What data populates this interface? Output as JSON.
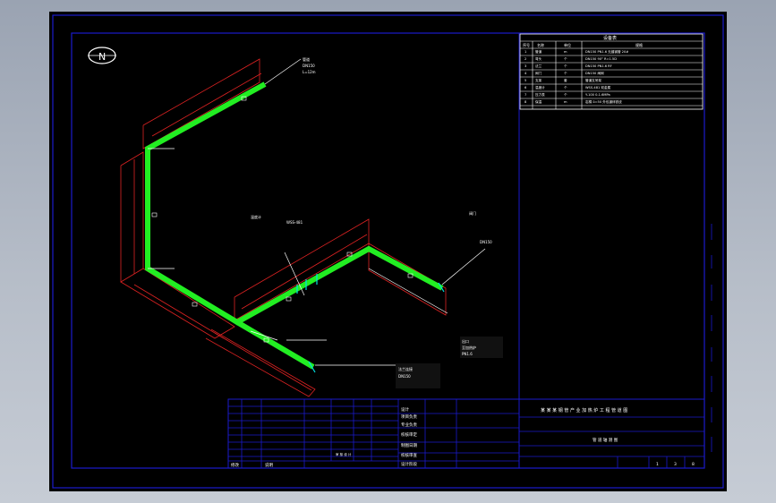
{
  "drawing": {
    "north_symbol": "N",
    "title_block": {
      "labels": [
        "设计",
        "项目负责",
        "专业负责",
        "校核审定",
        "制图日期",
        "校核审查",
        "设计阶段"
      ],
      "title": "某 某 某 钢 管 产 业 加 热 炉 工 程 管 道 图",
      "subtitle": "管 道 轴 测 图",
      "bottom_left_1": "修改",
      "bottom_left_2": "说明",
      "center_note": "审  核  设  计",
      "sheet_values": [
        "1",
        "3",
        "8"
      ]
    },
    "legend": {
      "header": "设备表",
      "columns": [
        "序号",
        "名称",
        "单位",
        "规格"
      ],
      "rows": [
        [
          "1",
          "管道",
          "m",
          "DN150 PN1.6 无缝钢管 20#"
        ],
        [
          "2",
          "弯头",
          "个",
          "DN150 90° R=1.5D"
        ],
        [
          "3",
          "法兰",
          "个",
          "DN150 PN1.6 RF"
        ],
        [
          "4",
          "阀门",
          "个",
          "DN150 闸阀"
        ],
        [
          "5",
          "支架",
          "套",
          "管道支吊架"
        ],
        [
          "6",
          "温度计",
          "个",
          "WSS-481 双金属"
        ],
        [
          "7",
          "压力表",
          "个",
          "Y-100 0-1.6MPa"
        ],
        [
          "8",
          "保温",
          "m",
          "岩棉 δ=50 外包镀锌铁皮"
        ]
      ]
    },
    "callouts": {
      "c1": [
        "管道",
        "DN150",
        "L=12m"
      ],
      "c2": [
        "温度计",
        "WSS-481"
      ],
      "c3": [
        "法兰连接",
        "DN150"
      ],
      "c4": [
        "出口",
        "至加热炉",
        "PN1.6"
      ],
      "c5": [
        "阀门",
        "DN150"
      ]
    }
  },
  "colors": {
    "pipe": "#22ee22",
    "frame": "#1a1acc",
    "support": "#dd2222",
    "leader": "#ffffff",
    "valve": "#00e0e0"
  }
}
